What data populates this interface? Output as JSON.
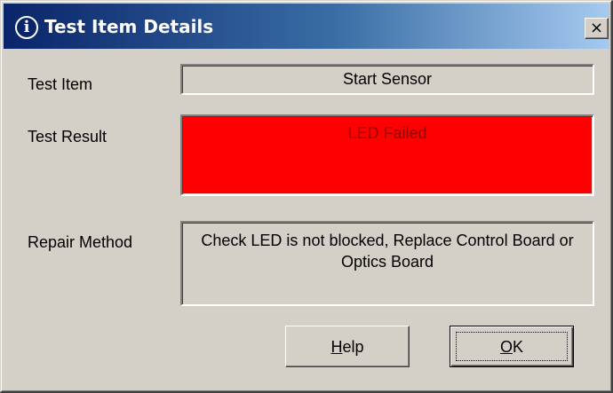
{
  "window": {
    "title": "Test Item Details",
    "title_icon": "info-icon",
    "title_icon_glyph": "i",
    "close_glyph": "×",
    "colors": {
      "title_gradient_start": "#0a246a",
      "title_gradient_end": "#a6caf0",
      "face": "#d4d0c8",
      "result_background": "#ff0000",
      "result_text": "#990000"
    }
  },
  "fields": {
    "test_item": {
      "label": "Test Item",
      "value": "Start Sensor"
    },
    "test_result": {
      "label": "Test Result",
      "value": "LED Failed"
    },
    "repair_method": {
      "label": "Repair Method",
      "value": "Check LED is not blocked, Replace Control Board or Optics Board"
    }
  },
  "buttons": {
    "help": {
      "mnemonic": "H",
      "rest": "elp"
    },
    "ok": {
      "mnemonic": "O",
      "rest": "K"
    }
  }
}
